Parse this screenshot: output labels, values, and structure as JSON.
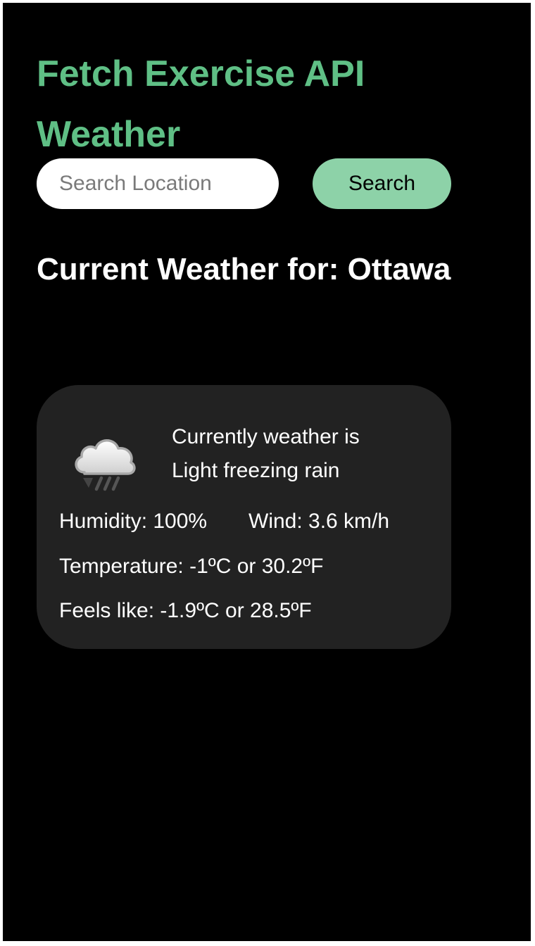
{
  "header": {
    "title": "Fetch Exercise API Weather"
  },
  "search": {
    "placeholder": "Search Location",
    "value": "",
    "button_label": "Search"
  },
  "current": {
    "heading": "Current Weather for: Ottawa"
  },
  "weather": {
    "icon": "light-freezing-rain-icon",
    "condition_line1": "Currently weather is",
    "condition_line2": "Light freezing rain",
    "humidity": "Humidity: 100%",
    "wind": "Wind: 3.6 km/h",
    "temperature": "Temperature: -1ºC or 30.2ºF",
    "feels_like": "Feels like: -1.9ºC or 28.5ºF"
  },
  "colors": {
    "background": "#000000",
    "title": "#5fbf85",
    "button": "#8dd2a8",
    "card": "#222222",
    "text": "#ffffff"
  }
}
